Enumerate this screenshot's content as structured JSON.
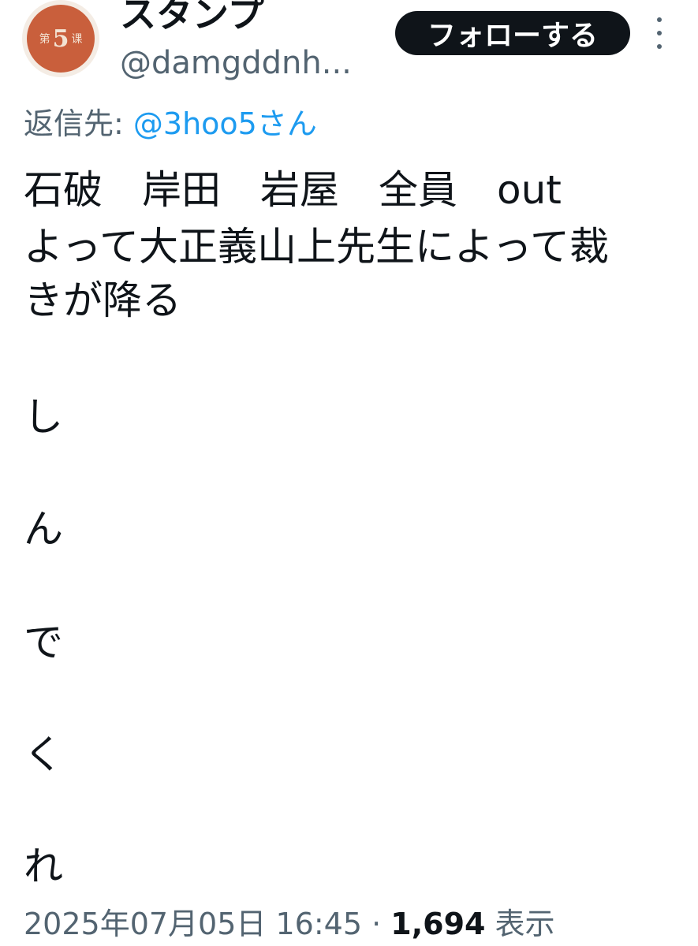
{
  "author": {
    "display_name": "スタンプ",
    "handle": "@damgddnh...",
    "avatar": {
      "small_left": "第",
      "big": "5",
      "small_right": "课",
      "bg_color": "#c95f3c"
    }
  },
  "actions": {
    "follow_label": "フォローする",
    "more_icon": "more-vertical-icon"
  },
  "reply": {
    "prefix": "返信先: ",
    "mention": "@3hoo5さん"
  },
  "tweet": {
    "lines": [
      "石破　岸田　岩屋　全員　out",
      "よって大正義山上先生によって裁",
      "きが降る",
      "し",
      "ん",
      "で",
      "く",
      "れ"
    ]
  },
  "meta": {
    "timestamp": "2025年07月05日 16:45",
    "separator": " · ",
    "views_count": "1,694",
    "views_label": " 表示"
  },
  "colors": {
    "text": "#0f1419",
    "secondary": "#536471",
    "link": "#1d9bf0",
    "button_bg": "#0f1419"
  }
}
